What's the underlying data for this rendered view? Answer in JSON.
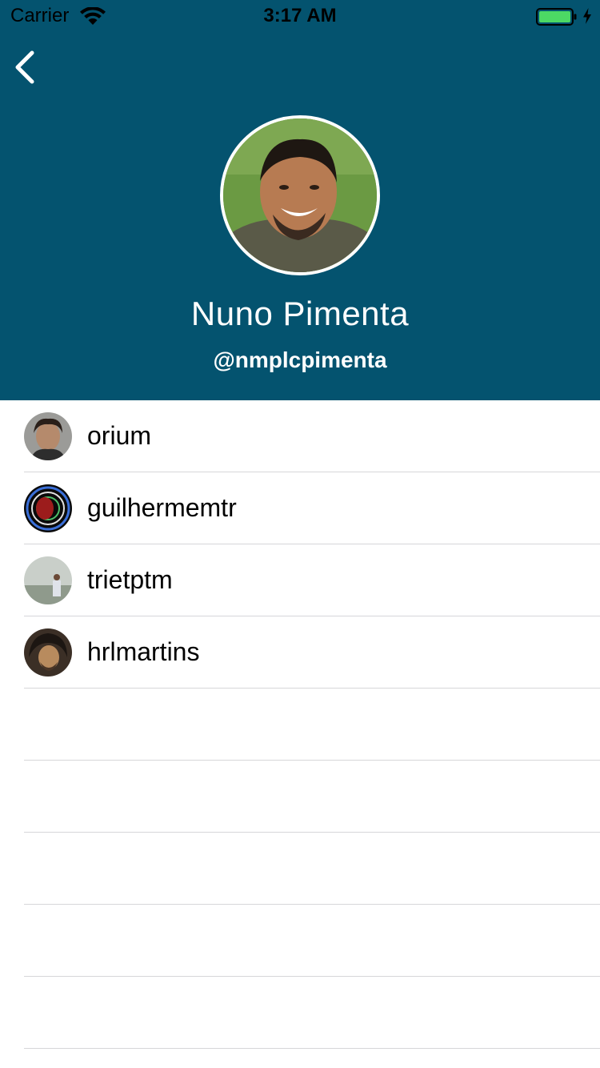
{
  "status_bar": {
    "carrier": "Carrier",
    "time": "3:17 AM",
    "battery_color": "#4cd964"
  },
  "nav": {
    "back_icon": "chevron-left-icon"
  },
  "profile": {
    "name": "Nuno Pimenta",
    "handle": "@nmplcpimenta",
    "header_color": "#04536f"
  },
  "list": {
    "items": [
      {
        "label": "orium"
      },
      {
        "label": "guilhermemtr"
      },
      {
        "label": "trietptm"
      },
      {
        "label": "hrlmartins"
      }
    ]
  }
}
